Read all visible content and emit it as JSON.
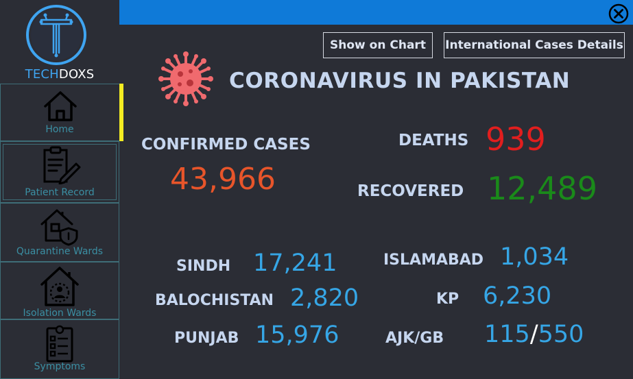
{
  "brand": {
    "part1": "TECH",
    "part2": "DOXS"
  },
  "sidebar": {
    "items": [
      {
        "label": "Home",
        "icon": "home-icon"
      },
      {
        "label": "Patient Record",
        "icon": "clipboard-edit-icon"
      },
      {
        "label": "Quarantine Wards",
        "icon": "house-shield-icon"
      },
      {
        "label": "Isolation Wards",
        "icon": "house-person-icon"
      },
      {
        "label": "Symptoms",
        "icon": "checklist-icon"
      }
    ],
    "active_index": 0
  },
  "toolbar": {
    "chart_button": "Show on Chart",
    "international_button": "International Cases Details"
  },
  "header": {
    "title": "CORONAVIRUS IN PAKISTAN"
  },
  "stats": {
    "confirmed_label": "CONFIRMED CASES",
    "confirmed_value": "43,966",
    "deaths_label": "DEATHS",
    "deaths_value": "939",
    "recovered_label": "RECOVERED",
    "recovered_value": "12,489"
  },
  "provinces": {
    "sindh": {
      "label": "SINDH",
      "value": "17,241"
    },
    "balochistan": {
      "label": "BALOCHISTAN",
      "value": "2,820"
    },
    "punjab": {
      "label": "PUNJAB",
      "value": "15,976"
    },
    "islamabad": {
      "label": "ISLAMABAD",
      "value": "1,034"
    },
    "kp": {
      "label": "KP",
      "value": "6,230"
    },
    "ajk_gb": {
      "label": "AJK/GB",
      "value_ajk": "115",
      "separator": "/",
      "value_gb": "550"
    }
  },
  "colors": {
    "background": "#2b2d35",
    "topbar": "#0f7ad8",
    "active_indicator": "#f4ec22",
    "confirmed": "#e8552a",
    "deaths": "#e11e1e",
    "recovered": "#1a8a1a",
    "province_value": "#36a6e6",
    "label": "#c6d6ef",
    "virus": "#f06a6e"
  }
}
